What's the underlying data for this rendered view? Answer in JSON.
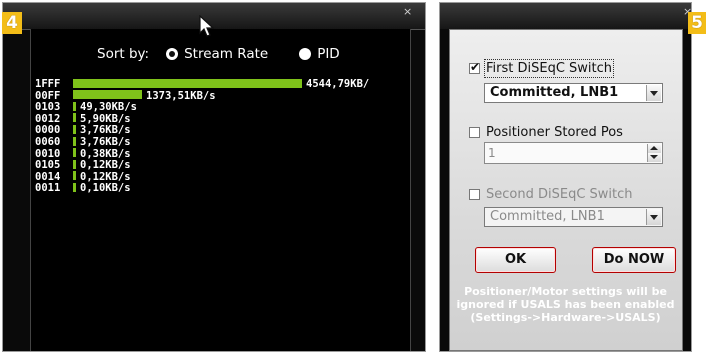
{
  "panel4": {
    "badge": "4",
    "close_glyph": "×",
    "sort": {
      "label": "Sort by:",
      "options": [
        {
          "label": "Stream Rate",
          "selected": true
        },
        {
          "label": "PID",
          "selected": false
        }
      ]
    },
    "bar_color": "#7fc21a",
    "streams": [
      {
        "pid": "1FFF",
        "rate": "4544,79KB/",
        "fraction": 1.0
      },
      {
        "pid": "00FF",
        "rate": "1373,51KB/s",
        "fraction": 0.302
      },
      {
        "pid": "0103",
        "rate": "49,30KB/s",
        "fraction": 0.011
      },
      {
        "pid": "0012",
        "rate": "5,90KB/s",
        "fraction": 0.0013
      },
      {
        "pid": "0000",
        "rate": "3,76KB/s",
        "fraction": 0.0008
      },
      {
        "pid": "0060",
        "rate": "3,76KB/s",
        "fraction": 0.0008
      },
      {
        "pid": "0010",
        "rate": "0,38KB/s",
        "fraction": 0.0001
      },
      {
        "pid": "0105",
        "rate": "0,12KB/s",
        "fraction": 3e-05
      },
      {
        "pid": "0014",
        "rate": "0,12KB/s",
        "fraction": 3e-05
      },
      {
        "pid": "0011",
        "rate": "0,10KB/s",
        "fraction": 2e-05
      }
    ]
  },
  "panel5": {
    "badge": "5",
    "close_glyph": "×",
    "first_switch": {
      "label": "First DiSEqC Switch",
      "checked": true,
      "value": "Committed, LNB1"
    },
    "positioner": {
      "label": "Positioner Stored Pos",
      "checked": false,
      "value": "1"
    },
    "second_switch": {
      "label": "Second DiSEqC Switch",
      "checked": false,
      "value": "Committed, LNB1"
    },
    "ok_label": "OK",
    "do_now_label": "Do NOW",
    "note": "Positioner/Motor settings will be ignored if USALS has been enabled (Settings->Hardware->USALS)",
    "accent": "#b30000"
  },
  "badge_color": "#f3bd18"
}
